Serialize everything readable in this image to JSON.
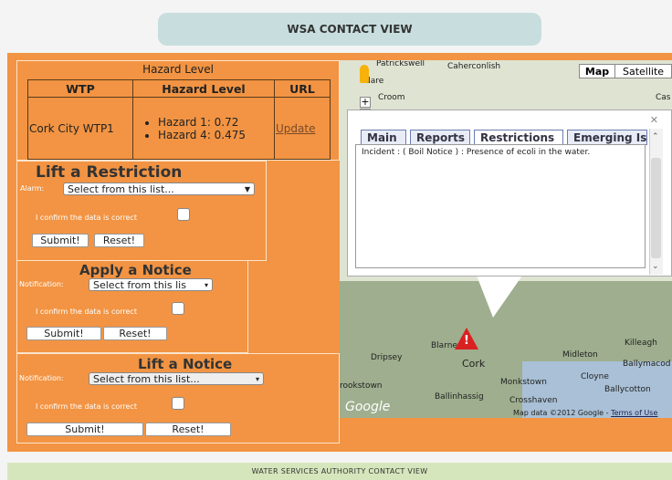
{
  "header": {
    "title": "WSA CONTACT VIEW"
  },
  "footer": {
    "text": "WATER SERVICES AUTHORITY CONTACT VIEW"
  },
  "hazard": {
    "caption": "Hazard Level",
    "columns": [
      "WTP",
      "Hazard Level",
      "URL"
    ],
    "row": {
      "wtp": "Cork City WTP1",
      "hazards": [
        "Hazard 1: 0.72",
        "Hazard 4: 0.475"
      ],
      "link": "Update"
    }
  },
  "lift_restriction": {
    "title": "Lift a Restriction",
    "alarm_label": "Alarm:",
    "select_value": "Select from this list...",
    "confirm_label": "I confirm the data is correct",
    "submit": "Submit!",
    "reset": "Reset!"
  },
  "apply_notice": {
    "title": "Apply a Notice",
    "notification_label": "Notification:",
    "select_value": "Select from this lis",
    "confirm_label": "I confirm the data is correct",
    "submit": "Submit!",
    "reset": "Reset!"
  },
  "lift_notice": {
    "title": "Lift a Notice",
    "notification_label": "Notification:",
    "select_value": "Select from this list...",
    "confirm_label": "I confirm the data is correct",
    "submit": "Submit!",
    "reset": "Reset!"
  },
  "map": {
    "type_buttons": [
      "Map",
      "Satellite"
    ],
    "labels": {
      "patrickswell": "Patrickswell",
      "caherconlish": "Caherconlish",
      "dare": "dare",
      "croom": "Croom",
      "cas": "Cas",
      "dripsey": "Dripsey",
      "blarney": "Blarney",
      "cork": "Cork",
      "midleton": "Midleton",
      "killeagh": "Killeagh",
      "cloyne": "Cloyne",
      "ballymacoda": "Ballymacod",
      "monkstown": "Monkstown",
      "ballycotton": "Ballycotton",
      "crookstown": "rookstown",
      "ballinhassig": "Ballinhassig",
      "crosshaven": "Crosshaven"
    },
    "google": "Google",
    "map_data": "Map data ©2012 Google -",
    "terms": "Terms of Use",
    "info": {
      "tabs": [
        "Main",
        "Reports",
        "Restrictions",
        "Emerging Is"
      ],
      "active_tab": "Restrictions",
      "incident": "Incident : ( Boil Notice ) : Presence of ecoli in the water."
    }
  }
}
